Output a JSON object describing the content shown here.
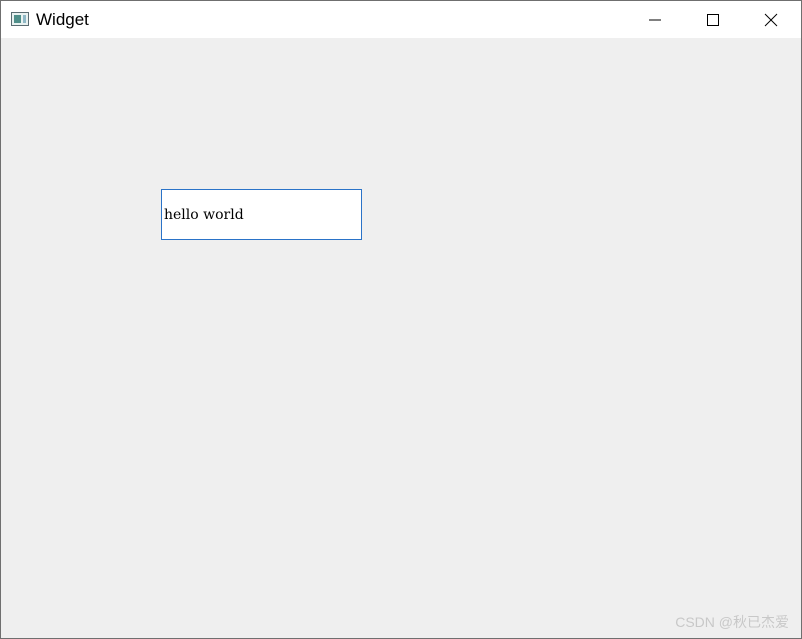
{
  "window": {
    "title": "Widget",
    "controls": {
      "minimize_icon": "minimize-icon",
      "maximize_icon": "maximize-icon",
      "close_icon": "close-icon"
    }
  },
  "client": {
    "text_field": {
      "value": "hello world"
    }
  },
  "watermark": {
    "text": "CSDN @秋已杰爱"
  },
  "colors": {
    "titlebar": "#ffffff",
    "client_background": "#efefef",
    "field_border": "#2a73c8",
    "watermark": "#c8c8c8"
  }
}
